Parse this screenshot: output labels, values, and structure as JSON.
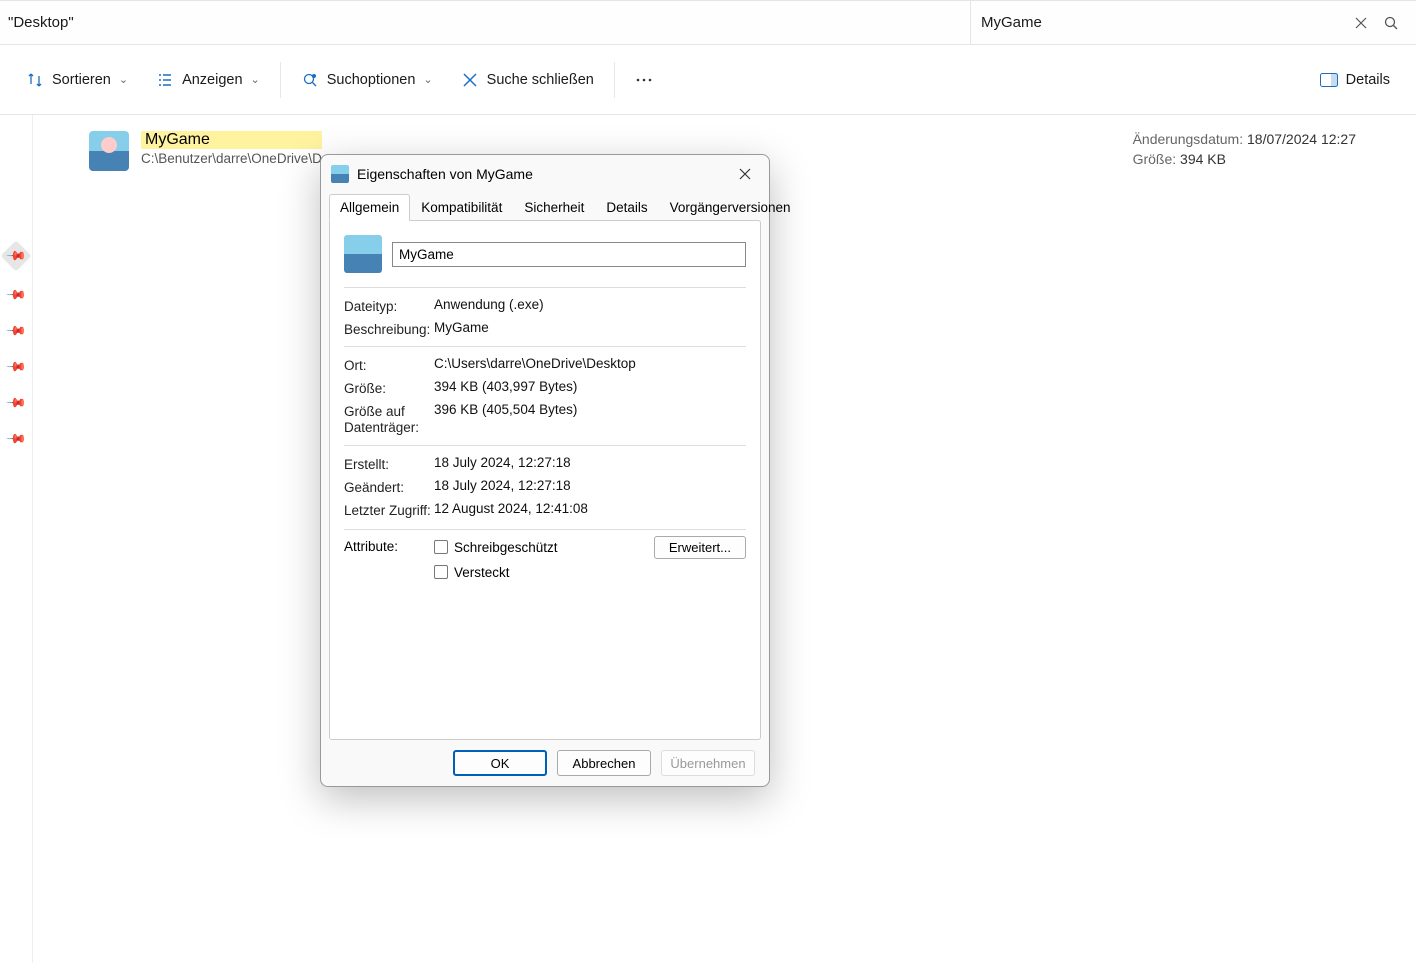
{
  "address_bar": {
    "path": "\"Desktop\""
  },
  "search": {
    "query": "MyGame"
  },
  "toolbar": {
    "sort": "Sortieren",
    "view": "Anzeigen",
    "search_options": "Suchoptionen",
    "close_search": "Suche schließen",
    "details": "Details"
  },
  "file": {
    "name": "MyGame",
    "path": "C:\\Benutzer\\darre\\OneDrive\\D"
  },
  "meta": {
    "modified_label": "Änderungsdatum:",
    "modified_value": "18/07/2024 12:27",
    "size_label": "Größe:",
    "size_value": "394 KB"
  },
  "dialog": {
    "title": "Eigenschaften von MyGame",
    "tabs": {
      "general": "Allgemein",
      "compat": "Kompatibilität",
      "security": "Sicherheit",
      "details": "Details",
      "previous": "Vorgängerversionen"
    },
    "name_value": "MyGame",
    "filetype_label": "Dateityp:",
    "filetype_value": "Anwendung (.exe)",
    "desc_label": "Beschreibung:",
    "desc_value": "MyGame",
    "location_label": "Ort:",
    "location_value": "C:\\Users\\darre\\OneDrive\\Desktop",
    "size_label": "Größe:",
    "size_value": "394 KB (403,997 Bytes)",
    "sizedisk_label": "Größe auf Datenträger:",
    "sizedisk_value": "396 KB (405,504 Bytes)",
    "created_label": "Erstellt:",
    "created_value": "18 July 2024, 12:27:18",
    "modified_label": "Geändert:",
    "modified_value": "18 July 2024, 12:27:18",
    "accessed_label": "Letzter Zugriff:",
    "accessed_value": "12 August 2024, 12:41:08",
    "attributes_label": "Attribute:",
    "readonly_label": "Schreibgeschützt",
    "hidden_label": "Versteckt",
    "advanced_button": "Erweitert...",
    "ok": "OK",
    "cancel": "Abbrechen",
    "apply": "Übernehmen"
  }
}
